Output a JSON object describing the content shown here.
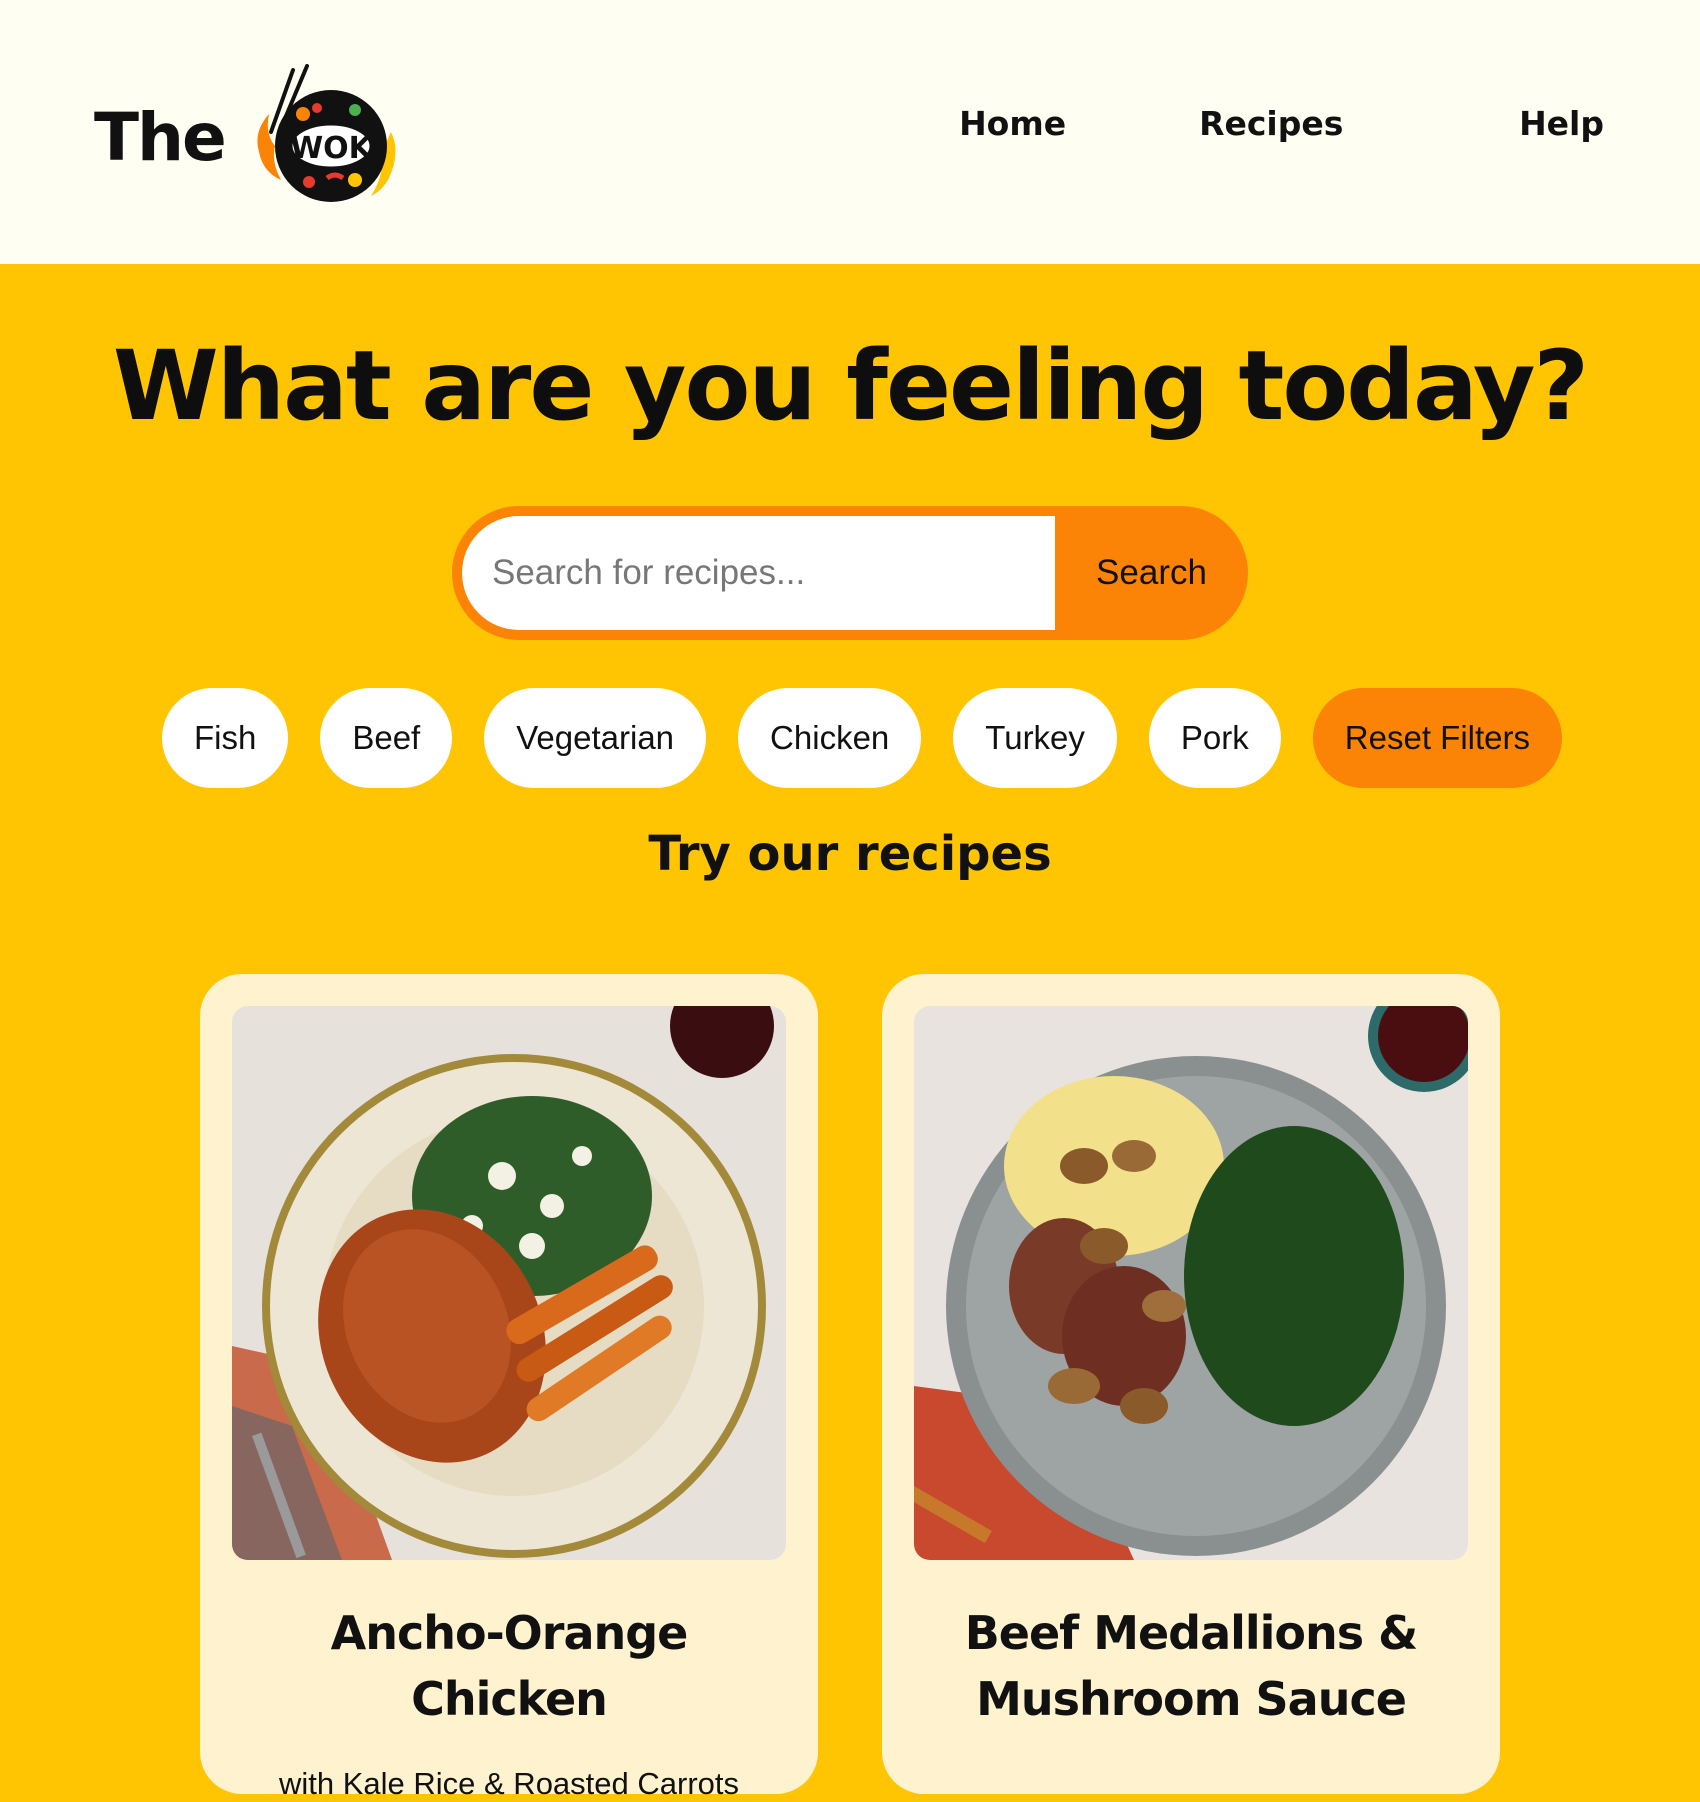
{
  "header": {
    "brand": "The",
    "logo_text": "WOK",
    "nav": [
      {
        "label": "Home"
      },
      {
        "label": "Recipes"
      },
      {
        "label": "Help"
      }
    ]
  },
  "hero": {
    "title": "What are you feeling today?",
    "search": {
      "placeholder": "Search for recipes...",
      "value": "",
      "button_label": "Search"
    },
    "filters": [
      "Fish",
      "Beef",
      "Vegetarian",
      "Chicken",
      "Turkey",
      "Pork"
    ],
    "reset_label": "Reset Filters"
  },
  "recipes_section": {
    "title": "Try our recipes",
    "cards": [
      {
        "title": "Ancho-Orange Chicken",
        "subtitle": "with Kale Rice & Roasted Carrots",
        "image": "chicken-plate-photo"
      },
      {
        "title": "Beef Medallions & Mushroom Sauce",
        "subtitle": "",
        "image": "beef-plate-photo"
      }
    ]
  },
  "colors": {
    "page_bg": "#ffc502",
    "header_bg": "#fffef2",
    "accent_orange": "#fb8406",
    "card_bg": "#fff2ce"
  }
}
